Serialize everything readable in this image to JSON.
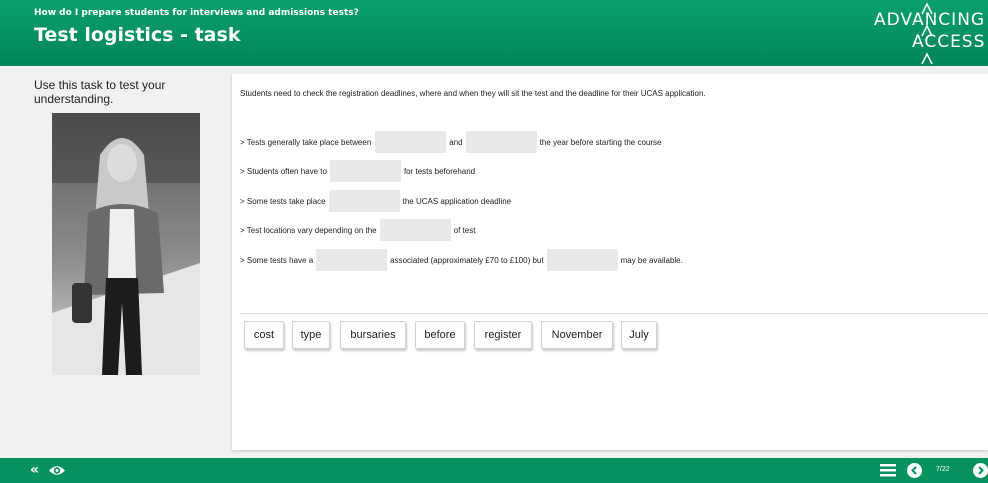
{
  "header": {
    "kicker": "How do I prepare students for interviews and admissions tests?",
    "title": "Test logistics - task",
    "logo_line1": "ADVANCING",
    "logo_line2": "ACCESS"
  },
  "sidebar": {
    "instruction": "Use this task to test your understanding."
  },
  "task": {
    "intro": "Students need to check the registration deadlines, where and when they will sit the test and the deadline for their UCAS application.",
    "line1": {
      "a": "> Tests generally take place between",
      "b": "and",
      "c": "the year before starting the course"
    },
    "line2": {
      "a": "> Students often have to",
      "b": "for tests beforehand"
    },
    "line3": {
      "a": "> Some tests take place",
      "b": "the UCAS application deadline"
    },
    "line4": {
      "a": "> Test locations vary depending on the",
      "b": "of test"
    },
    "line5": {
      "a": "> Some tests have a",
      "b": "associated (approximately £70 to £100) but",
      "c": "may be available."
    },
    "word_bank": [
      "cost",
      "type",
      "bursaries",
      "before",
      "register",
      "November",
      "July"
    ]
  },
  "footer": {
    "page_indicator": "7/22"
  },
  "colors": {
    "brand_green": "#069462",
    "gap_fill": "#e9e9e9"
  },
  "icons": [
    "collapse-icon",
    "eye-icon",
    "menu-icon",
    "prev-icon",
    "next-icon"
  ]
}
